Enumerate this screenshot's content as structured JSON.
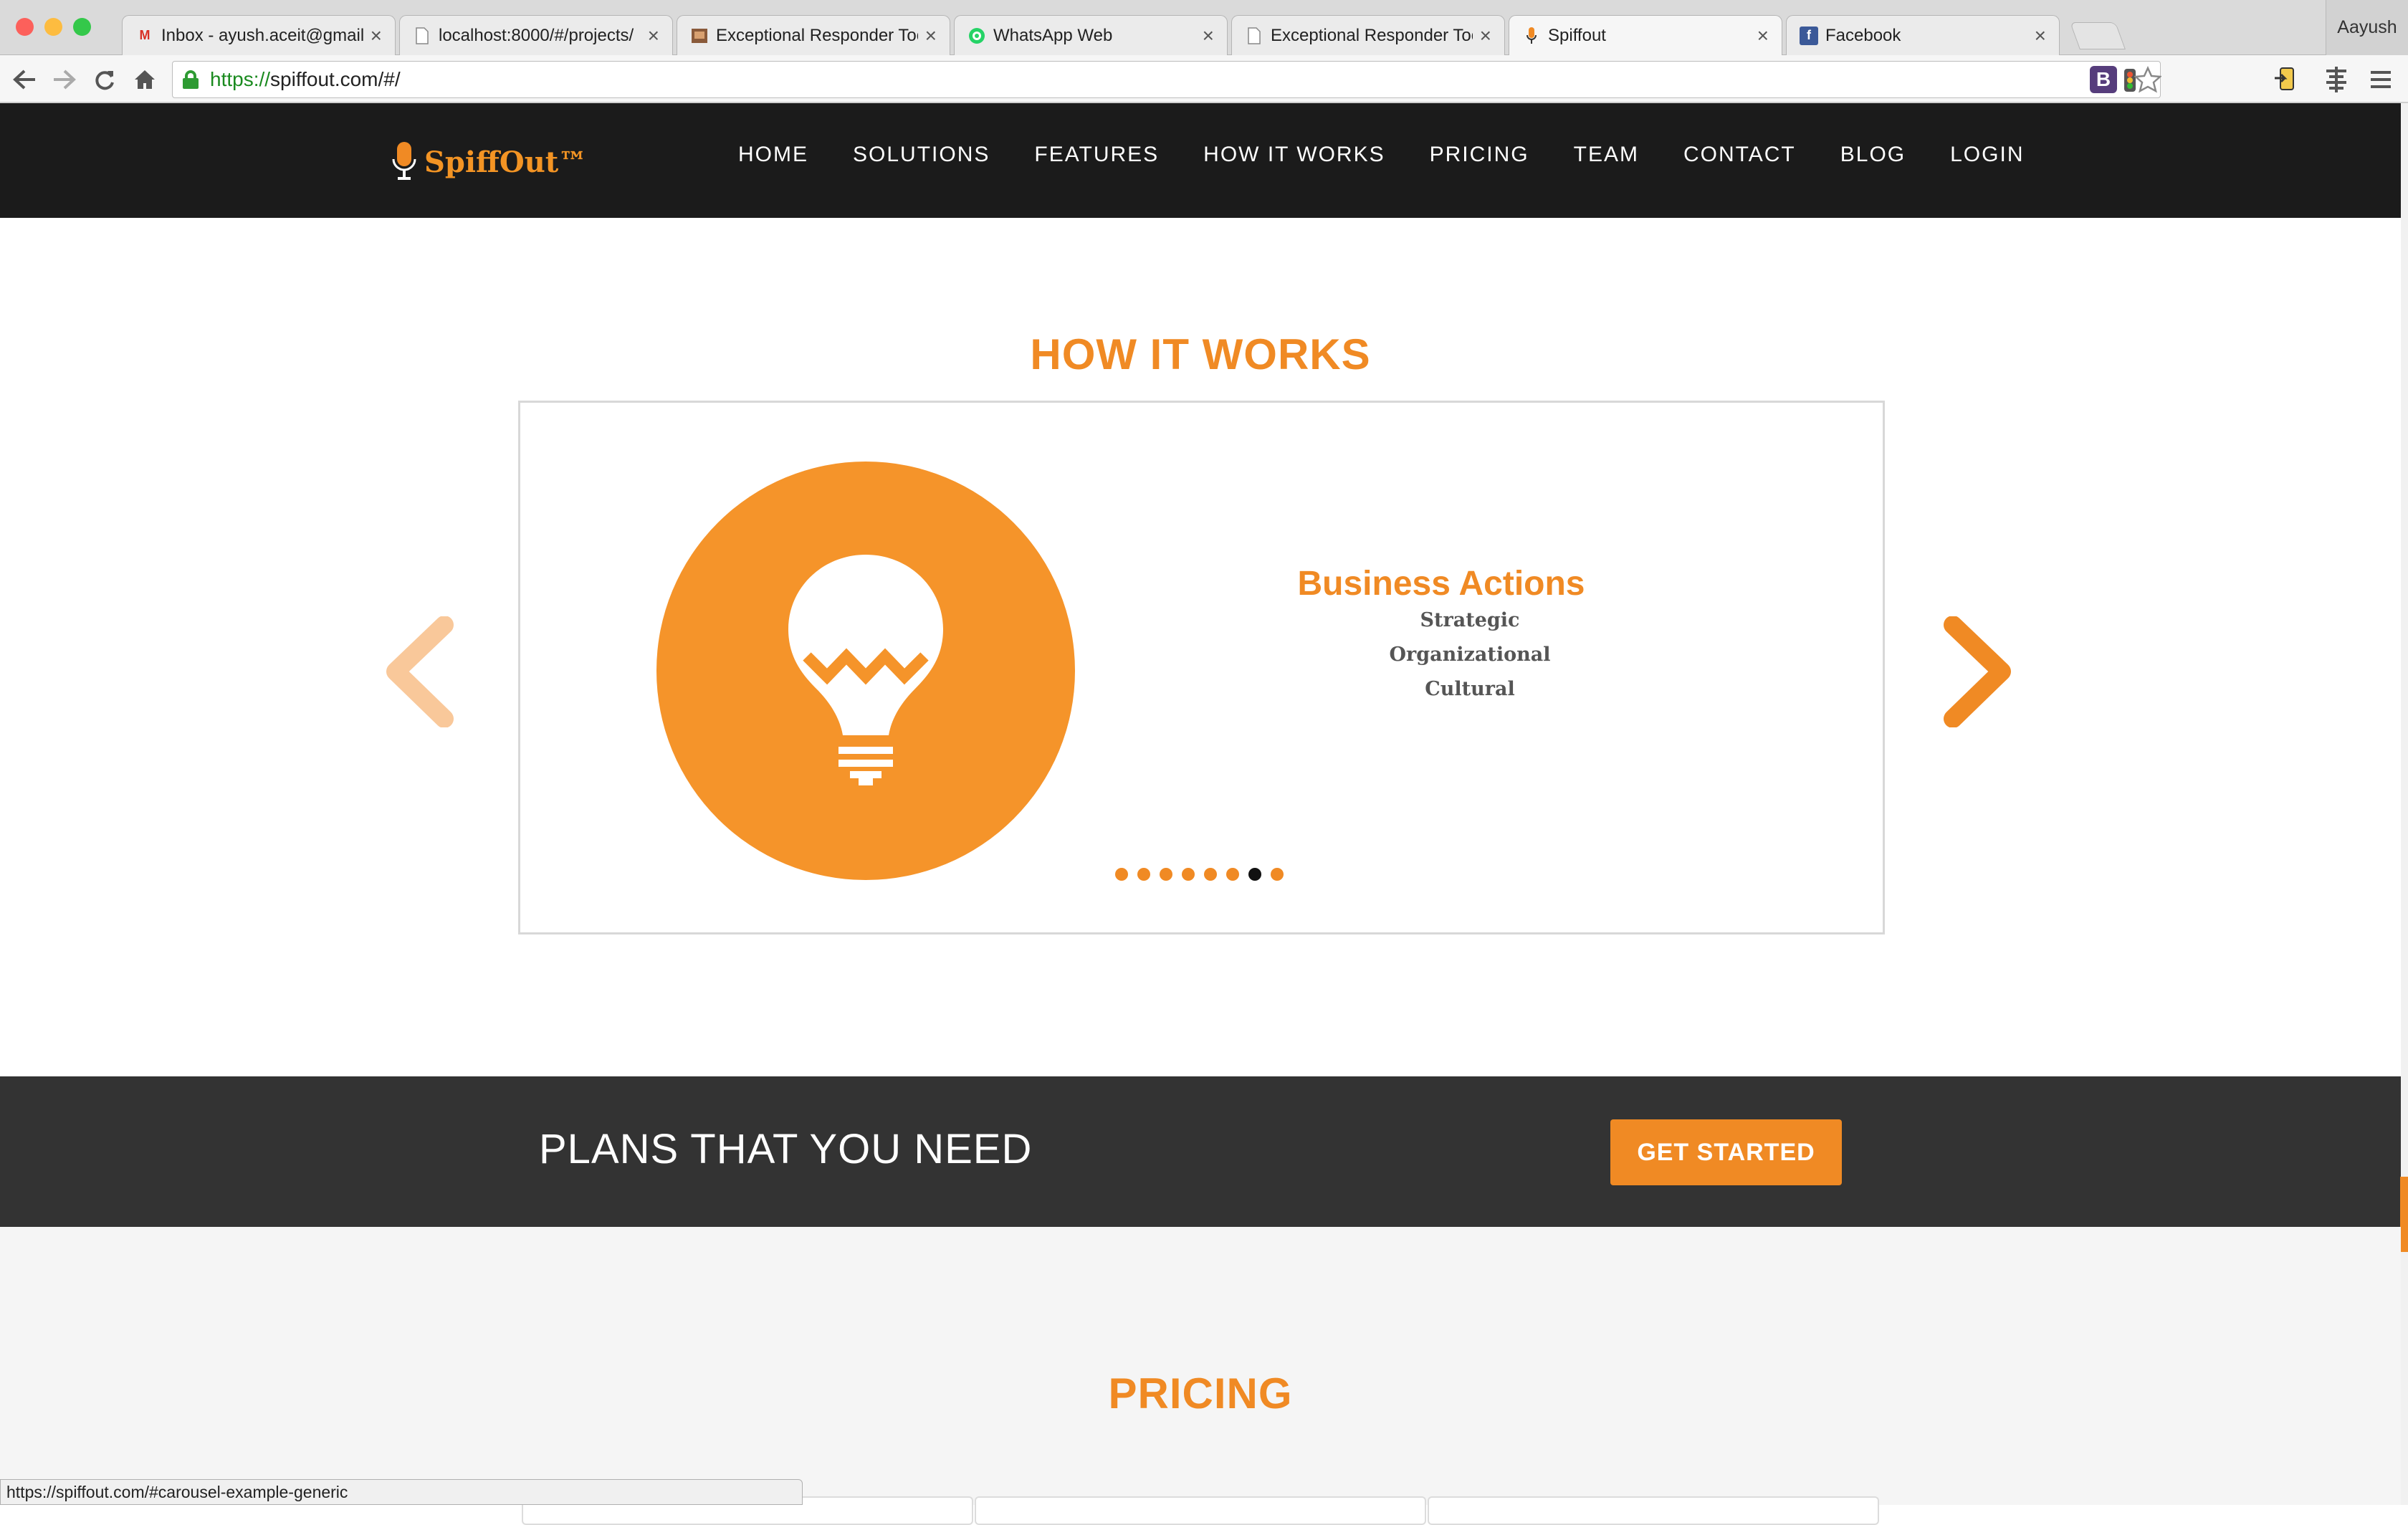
{
  "browser": {
    "tabs": [
      {
        "title": "Inbox - ayush.aceit@gmail.",
        "icon": "gmail-icon",
        "active": false
      },
      {
        "title": "localhost:8000/#/projects/",
        "icon": "page-icon",
        "active": false
      },
      {
        "title": "Exceptional Responder Too",
        "icon": "responder-icon",
        "active": false
      },
      {
        "title": "WhatsApp Web",
        "icon": "whatsapp-icon",
        "active": false
      },
      {
        "title": "Exceptional Responder Too",
        "icon": "page-icon",
        "active": false
      },
      {
        "title": "Spiffout",
        "icon": "spiffout-icon",
        "active": true
      },
      {
        "title": "Facebook",
        "icon": "facebook-icon",
        "active": false
      }
    ],
    "profile": "Aayush",
    "url_scheme": "https://",
    "url_rest": "spiffout.com/#/",
    "status_url": "https://spiffout.com/#carousel-example-generic"
  },
  "site": {
    "logo": "SpiffOut™",
    "nav": [
      "HOME",
      "SOLUTIONS",
      "FEATURES",
      "HOW IT WORKS",
      "PRICING",
      "TEAM",
      "CONTACT",
      "BLOG",
      "LOGIN"
    ]
  },
  "how_it_works": {
    "title": "HOW IT WORKS",
    "slide": {
      "title": "Business Actions",
      "items": [
        "Strategic",
        "Organizational",
        "Cultural"
      ]
    },
    "indicator_count": 8,
    "active_indicator": 7
  },
  "plans": {
    "text": "PLANS THAT YOU NEED",
    "button": "GET STARTED"
  },
  "pricing": {
    "title": "PRICING"
  },
  "colors": {
    "accent": "#f08a24",
    "header_bg": "#1b1b1b",
    "band_bg": "#333333"
  }
}
